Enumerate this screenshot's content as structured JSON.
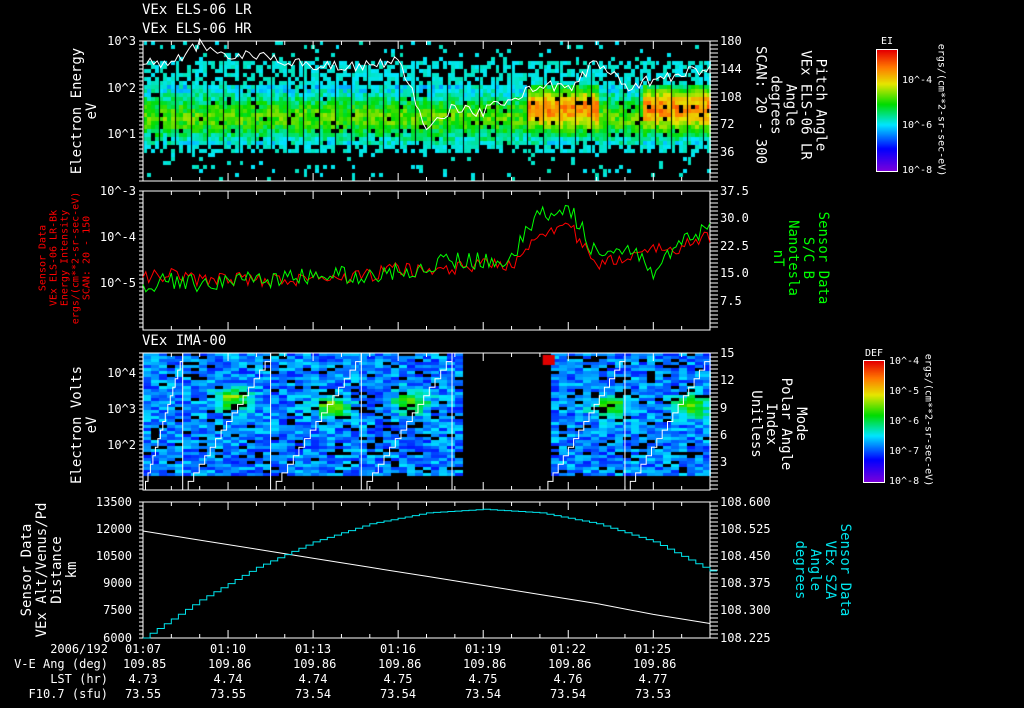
{
  "titles": {
    "lr": "VEx ELS-06 LR",
    "hr": "VEx ELS-06 HR",
    "ima": "VEx IMA-00"
  },
  "colors": {
    "background": "#000000",
    "axis": "#ffffff",
    "red_series": "#ff0000",
    "green_series": "#00ff00",
    "cyan_series": "#00e5ee",
    "white_series": "#ffffff"
  },
  "panel1": {
    "left_label": [
      "Electron Energy",
      "eV"
    ],
    "right_label": [
      "Pitch Angle",
      "VEx ELS-06 LR",
      "Angle",
      "degrees",
      "SCAN: 20 - 300"
    ],
    "left_ticks": [
      "10^3",
      "10^2",
      "10^1"
    ],
    "right_ticks": [
      "180",
      "144",
      "108",
      "72",
      "36"
    ],
    "colorbar": {
      "title": "EI",
      "ticks": [
        "10^-4",
        "10^-6",
        "10^-8"
      ],
      "units": "ergs/(cm**2-sr-sec-eV)"
    }
  },
  "panel2": {
    "left_label": [
      "Sensor Data",
      "VEx ELS-06 LR-Bk",
      "Energy Intensity",
      "ergs/(cm**2-sr-sec-eV)",
      "SCAN: 20 - 150"
    ],
    "right_label": [
      "Sensor Data",
      "S/C B",
      "Nanotesla",
      "nT"
    ],
    "left_ticks": [
      "10^-3",
      "10^-4",
      "10^-5"
    ],
    "right_ticks": [
      "37.5",
      "30.0",
      "22.5",
      "15.0",
      "7.5"
    ]
  },
  "panel3": {
    "left_label": [
      "Electron Volts",
      "eV"
    ],
    "right_label": [
      "Mode",
      "Polar Angle",
      "Index",
      "Unitless"
    ],
    "left_ticks": [
      "10^4",
      "10^3",
      "10^2"
    ],
    "right_ticks": [
      "15",
      "12",
      "9",
      "6",
      "3"
    ],
    "colorbar": {
      "title": "DEF",
      "ticks": [
        "10^-4",
        "10^-5",
        "10^-6",
        "10^-7",
        "10^-8"
      ],
      "units": "ergs/(cm**2-sr-sec-eV)"
    }
  },
  "panel4": {
    "left_label": [
      "Sensor Data",
      "VEx Alt/Venus/Pd",
      "Distance",
      "km"
    ],
    "right_label": [
      "Sensor Data",
      "VEx SZA",
      "Angle",
      "degrees"
    ],
    "left_ticks": [
      "13500",
      "12000",
      "10500",
      "9000",
      "7500",
      "6000"
    ],
    "right_ticks": [
      "108.600",
      "108.525",
      "108.450",
      "108.375",
      "108.300",
      "108.225"
    ]
  },
  "footer": {
    "row_labels": [
      "2006/192",
      "V-E Ang (deg)",
      "LST (hr)",
      "F10.7 (sfu)"
    ],
    "columns": [
      {
        "time": "01:07",
        "ve_ang": "109.85",
        "lst": "4.73",
        "f107": "73.55"
      },
      {
        "time": "01:10",
        "ve_ang": "109.86",
        "lst": "4.74",
        "f107": "73.55"
      },
      {
        "time": "01:13",
        "ve_ang": "109.86",
        "lst": "4.74",
        "f107": "73.54"
      },
      {
        "time": "01:16",
        "ve_ang": "109.86",
        "lst": "4.75",
        "f107": "73.54"
      },
      {
        "time": "01:19",
        "ve_ang": "109.86",
        "lst": "4.75",
        "f107": "73.54"
      },
      {
        "time": "01:22",
        "ve_ang": "109.86",
        "lst": "4.76",
        "f107": "73.54"
      },
      {
        "time": "01:25",
        "ve_ang": "109.86",
        "lst": "4.77",
        "f107": "73.53"
      }
    ]
  },
  "chart_data": [
    {
      "type": "heatmap",
      "name": "VEx ELS-06 LR",
      "x_range": [
        "01:07",
        "01:27"
      ],
      "ylim": [
        1,
        1000
      ],
      "y_scale": "log",
      "ylim_right": [
        0,
        180
      ],
      "color_range": [
        1e-08,
        0.001
      ],
      "color_scale": "log",
      "colormap": "rainbow",
      "overlay_line": {
        "color": "#ffffff",
        "x_min": [
          0,
          1,
          2,
          3,
          4,
          5,
          6,
          7,
          8,
          9,
          10,
          11,
          12,
          13,
          14,
          15,
          16,
          17,
          18,
          19,
          20
        ],
        "y": [
          400,
          300,
          850,
          500,
          450,
          380,
          320,
          280,
          300,
          400,
          15,
          40,
          30,
          60,
          120,
          90,
          400,
          100,
          150,
          200,
          250
        ]
      }
    },
    {
      "type": "line",
      "x_min": [
        0,
        1,
        2,
        3,
        4,
        5,
        6,
        7,
        8,
        9,
        10,
        11,
        12,
        13,
        14,
        15,
        16,
        17,
        18,
        19,
        20
      ],
      "series": [
        {
          "axis": "left",
          "color": "#ff0000",
          "ylim": [
            1e-06,
            0.001
          ],
          "y_scale": "log",
          "values": [
            1.3e-05,
            1.6e-05,
            1.2e-05,
            1.3e-05,
            1.2e-05,
            1.2e-05,
            1.3e-05,
            1.3e-05,
            1.5e-05,
            2.2e-05,
            1.8e-05,
            2.2e-05,
            2.6e-05,
            2.6e-05,
            0.00013,
            0.0002,
            2.2e-05,
            4e-05,
            5e-05,
            6.5e-05,
            0.0001
          ]
        },
        {
          "axis": "right",
          "color": "#00ff00",
          "ylim": [
            0,
            37.5
          ],
          "values": [
            12.5,
            13,
            12.8,
            13.2,
            14,
            13.8,
            14.5,
            15,
            14,
            16,
            17,
            19,
            18.5,
            20,
            31,
            34,
            20,
            22,
            16,
            24,
            27
          ]
        }
      ]
    },
    {
      "type": "heatmap",
      "name": "VEx IMA-00",
      "x_range": [
        "01:07",
        "01:27"
      ],
      "ylim": [
        6,
        30000
      ],
      "y_scale": "log",
      "ylim_right": [
        0,
        15
      ],
      "color_range": [
        1e-08,
        0.0001
      ],
      "color_scale": "log",
      "colormap": "rainbow",
      "data_gap": [
        "01:18",
        "01:21"
      ]
    },
    {
      "type": "line",
      "x_min": [
        0,
        2,
        4,
        6,
        8,
        10,
        12,
        14,
        16,
        18,
        20
      ],
      "series": [
        {
          "axis": "left",
          "color": "#ffffff",
          "ylim": [
            6000,
            13500
          ],
          "values": [
            11900,
            11400,
            10900,
            10400,
            9900,
            9400,
            8900,
            8400,
            7900,
            7300,
            6800
          ]
        },
        {
          "axis": "right",
          "color": "#00e5ee",
          "ylim": [
            108.225,
            108.6
          ],
          "values": [
            108.225,
            108.33,
            108.42,
            108.49,
            108.54,
            108.57,
            108.58,
            108.57,
            108.54,
            108.49,
            108.41
          ]
        }
      ]
    }
  ]
}
